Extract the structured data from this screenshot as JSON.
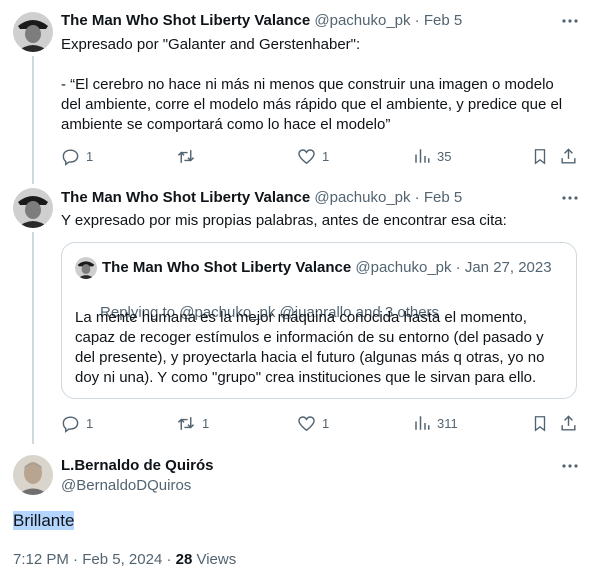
{
  "tweet1": {
    "name": "The Man Who Shot Liberty Valance",
    "handle": "@pachuko_pk",
    "sep": "·",
    "date": "Feb 5",
    "line1": "Expresado por \"Galanter and Gerstenhaber\":",
    "line2": "- “El cerebro no hace ni más ni menos que construir una imagen o modelo",
    "line3": "del ambiente, corre el modelo más rápido que el ambiente, y predice que el",
    "line4": "ambiente se comportará como lo hace el modelo”",
    "replies": "1",
    "retweets": "",
    "likes": "1",
    "views": "35"
  },
  "tweet2": {
    "name": "The Man Who Shot Liberty Valance",
    "handle": "@pachuko_pk",
    "sep": "·",
    "date": "Feb 5",
    "line1": "Y expresado por mis propias palabras, antes de encontrar esa cita:",
    "replies": "1",
    "retweets": "1",
    "likes": "1",
    "views": "311"
  },
  "quote": {
    "name": "The Man Who Shot Liberty Valance",
    "handle": "@pachuko_pk",
    "sep": "·",
    "date": "Jan 27, 2023",
    "replying_prefix": "Replying to ",
    "replying_users": "@pachuko_pk @juanrallo",
    "replying_and": " and ",
    "replying_others": "3 others",
    "line1": "La mente humana es la mejor máquina conocida hasta el momento,",
    "line2": "capaz de recoger estímulos e información de su entorno (del pasado y",
    "line3": "del presente), y proyectarla hacia el futuro (algunas más q otras, yo no",
    "line4": "doy ni una). Y como \"grupo\" crea instituciones que le sirvan para ello."
  },
  "main": {
    "name": "L.Bernaldo de Quirós",
    "handle": "@BernaldoDQuiros",
    "text": "Brillante",
    "time": "7:12 PM",
    "sep": "·",
    "date": "Feb 5, 2024",
    "sep2": "·",
    "views_count": "28",
    "views_label": "Views"
  },
  "colors": {
    "accent": "#1d9bf0",
    "muted": "#536471",
    "border": "#cfd9de",
    "selection": "#b4d5fe"
  },
  "icons": [
    "more-icon",
    "reply-icon",
    "retweet-icon",
    "like-icon",
    "views-icon",
    "bookmark-icon",
    "share-icon"
  ]
}
